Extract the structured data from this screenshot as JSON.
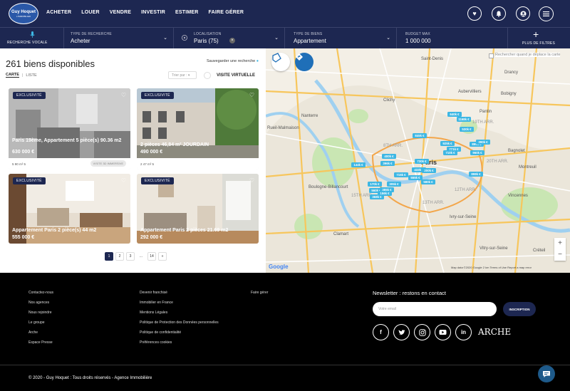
{
  "brand": {
    "name": "Guy Hoquet",
    "tagline": "L'IMMOBILIER"
  },
  "nav": [
    "ACHETER",
    "LOUER",
    "VENDRE",
    "INVESTIR",
    "ESTIMER",
    "FAIRE GÉRER"
  ],
  "search": {
    "voice_label": "RECHERCHE VOCALE",
    "type_label": "TYPE DE RECHERCHE",
    "type_value": "Acheter",
    "location_label": "LOCALISATION",
    "location_value": "Paris (75)",
    "goods_label": "TYPE DE BIENS",
    "goods_value": "Appartement",
    "budget_label": "BUDGET MAX",
    "budget_value": "1 000 000",
    "filters_label": "PLUS DE FILTRES"
  },
  "results": {
    "count_label": "261 biens disponibles",
    "save_search": "Sauvegarder une recherche",
    "tab_map": "CARTE",
    "tab_list": "LISTE",
    "sort_placeholder": "Trier par :",
    "virtual_visit": "VISITE VIRTUELLE"
  },
  "listings": [
    {
      "badge": "EXCLUSIVITÉ",
      "title": "Paris 19ème, Appartement 5 pièce(s) 90.36 m2",
      "price": "630 000 €",
      "meta": "5   90 m²   5",
      "visit": "VISITE 3D IMMERSIVE"
    },
    {
      "badge": "EXCLUSIVITÉ",
      "title": "2 pièces 46,84 m² JOURDAIN",
      "price": "490 000 €",
      "meta": "2   47 m²   5",
      "visit": ""
    },
    {
      "badge": "EXCLUSIVITÉ",
      "title": "Appartement Paris 2 pièce(s) 44 m2",
      "price": "555 000 €",
      "meta": "",
      "visit": ""
    },
    {
      "badge": "EXCLUSIVITÉ",
      "title": "Appartement Paris 2 pièces 21.69 m2",
      "price": "292 000 €",
      "meta": "",
      "visit": ""
    }
  ],
  "pagination": [
    "1",
    "2",
    "3",
    "...",
    "14",
    "»"
  ],
  "map": {
    "search_toggle": "Rechercher quand je déplace la carte",
    "labels": [
      "Saint-Denis",
      "Nanterre",
      "Clichy",
      "Paris",
      "Boulogne-Billancourt",
      "Montreuil",
      "Vincennes",
      "Créteil",
      "Aubervilliers",
      "Drancy",
      "Bobigny",
      "Bagnolet",
      "Pantin",
      "Rueil-Malmaison",
      "Ivry-sur-Seine",
      "Vitry-sur-Seine",
      "Clamart",
      "8TH ARR.",
      "13TH ARR.",
      "15TH ARR.",
      "19TH ARR.",
      "20TH ARR.",
      "12TH ARR."
    ],
    "prices": [
      "640k €",
      "1168k €",
      "845k €",
      "925k €",
      "771k €",
      "530k €",
      "710k €",
      "899k €",
      "390k €",
      "960k €",
      "433k €",
      "555k €",
      "580k €",
      "400k €",
      "396k €",
      "730k €",
      "170k €",
      "560k €",
      "385k €",
      "368k €",
      "200k €",
      "898k €",
      "305k €",
      "156k €",
      "715k €",
      "144k €"
    ],
    "credits": "Map data ©2020 Google   2 km   Terms of Use   Report a map error",
    "google": "Google"
  },
  "footer": {
    "col1": [
      "Contactez-nous",
      "Nos agences",
      "Nous rejoindre",
      "Le groupe",
      "Arche",
      "Espace Presse"
    ],
    "col2": [
      "Devenir franchisé",
      "Immobilier en France",
      "Mentions Légales",
      "Politique de Protection des Données personnelles",
      "Politique de confidentialité",
      "Préférences cookies"
    ],
    "col3": [
      "Faire gérer"
    ],
    "newsletter": "Newsletter : restons en contact",
    "email_placeholder": "Votre email",
    "subscribe": "INSCRIPTION",
    "arche": "ARCHE",
    "copyright": "© 2020 - Guy Hoquet : Tous droits réservés - Agence Immobilière"
  }
}
